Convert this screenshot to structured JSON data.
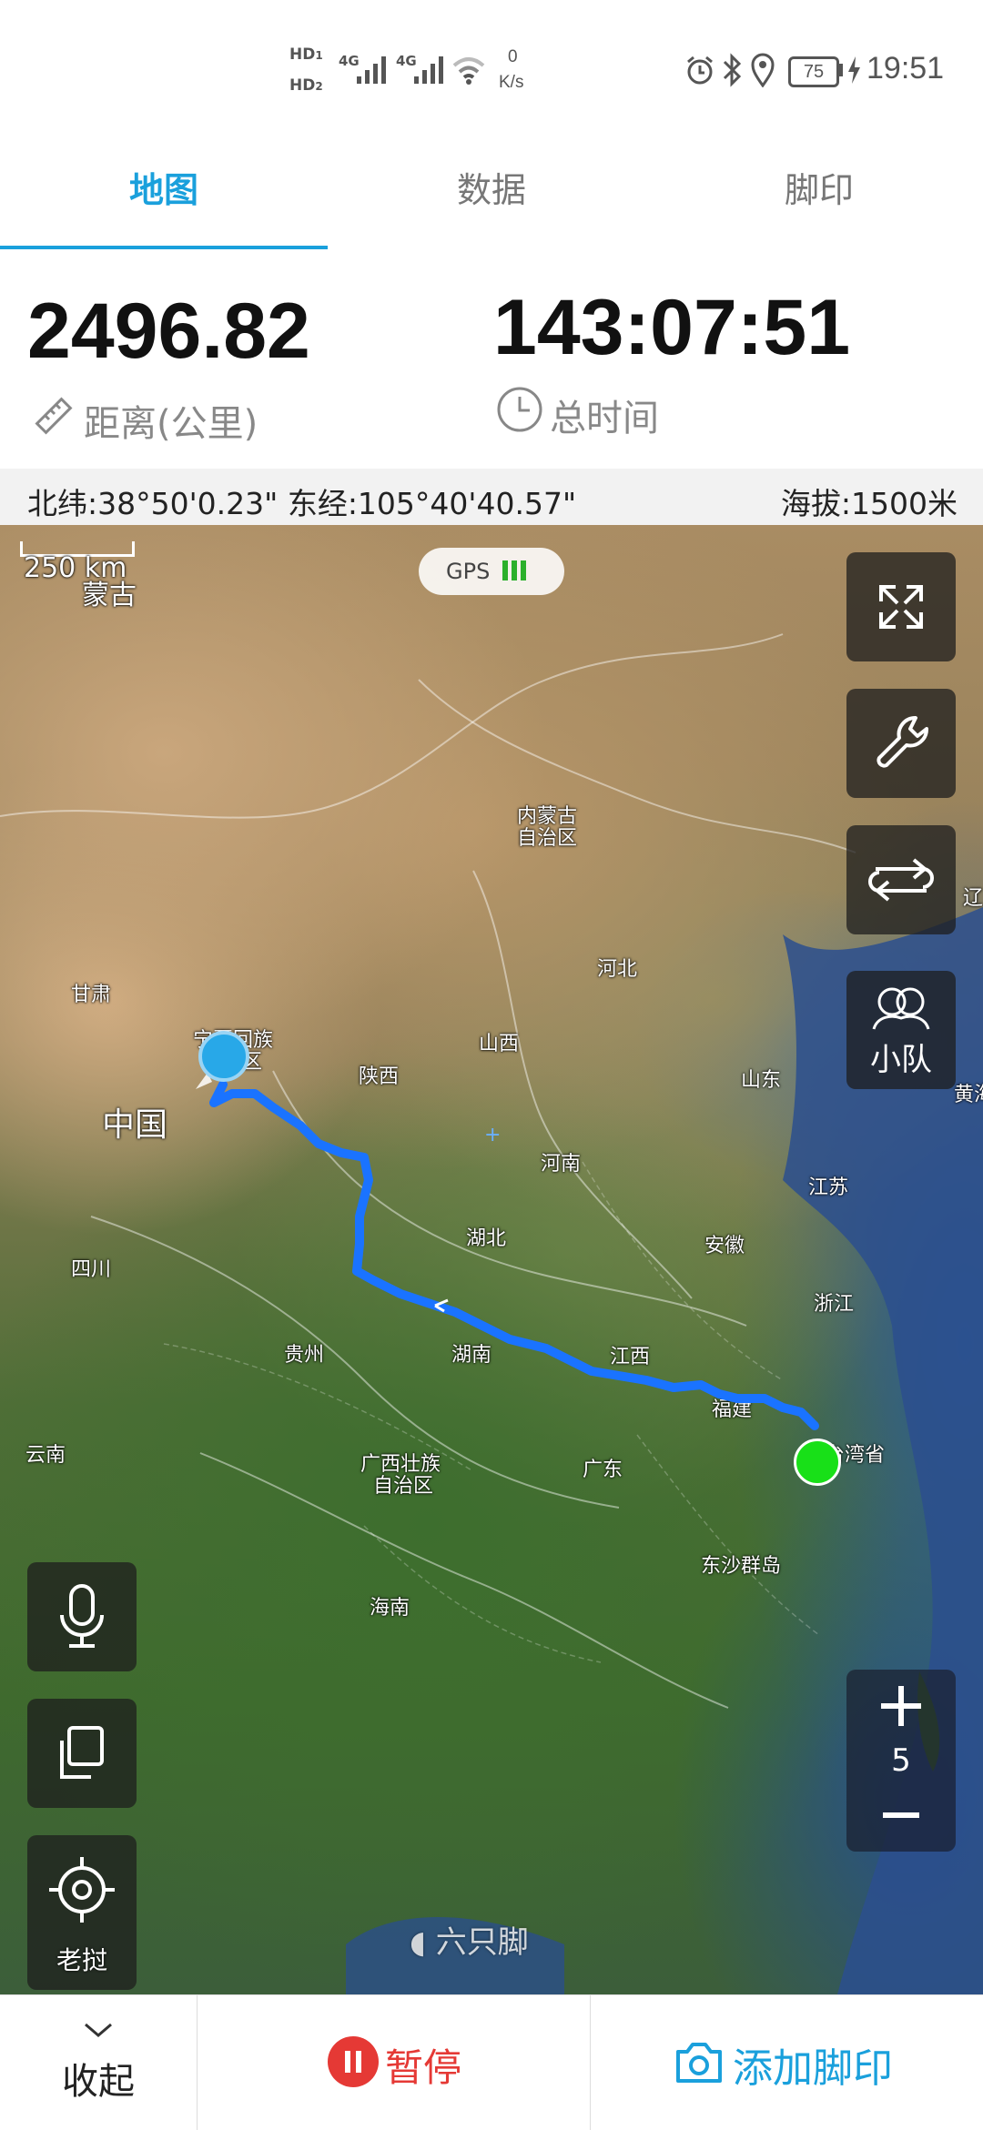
{
  "status_bar": {
    "hd1": "HD",
    "hd1_sub": "1",
    "hd2": "HD",
    "hd2_sub": "2",
    "signal1": "4G",
    "signal2": "4G",
    "net_speed_value": "0",
    "net_speed_unit": "K/s",
    "battery": "75",
    "time": "19:51",
    "icons": [
      "alarm-icon",
      "bluetooth-icon",
      "location-icon",
      "battery-icon",
      "charging-icon"
    ]
  },
  "tabs": [
    {
      "label": "地图",
      "active": true
    },
    {
      "label": "数据",
      "active": false
    },
    {
      "label": "脚印",
      "active": false
    }
  ],
  "stats": {
    "distance_value": "2496.82",
    "distance_label": "距离(公里)",
    "time_value": "143:07:51",
    "time_label": "总时间"
  },
  "coords": {
    "latlng": "北纬:38°50'0.23\" 东经:105°40'40.57\"",
    "altitude": "海拔:1500米"
  },
  "map": {
    "scale": "250 km",
    "gps_label": "GPS",
    "labels": {
      "mongolia": "蒙古",
      "inner_mongolia_1": "内蒙古",
      "inner_mongolia_2": "自治区",
      "gansu": "甘肃",
      "ningxia_1": "宁夏回族",
      "ningxia_2": "自治区",
      "hebei": "河北",
      "shanxi": "山西",
      "shaanxi": "陕西",
      "shandong": "山东",
      "china": "中国",
      "henan": "河南",
      "jiangsu": "江苏",
      "hubei": "湖北",
      "anhui": "安徽",
      "sichuan": "四川",
      "zhejiang": "浙江",
      "guizhou": "贵州",
      "hunan": "湖南",
      "jiangxi": "江西",
      "fujian": "福建",
      "yunnan": "云南",
      "guangxi_1": "广西壮族",
      "guangxi_2": "自治区",
      "guangdong": "广东",
      "taiwan": "台湾省",
      "hainan": "海南",
      "dongsha": "东沙群岛",
      "yellow_sea": "黄海",
      "liaoning": "辽"
    },
    "team_label": "小队",
    "zoom_level": "5",
    "locate_label": "老挝",
    "watermark": "六只脚",
    "accent": "#1a73ff",
    "start_color": "#18e018"
  },
  "bottom": {
    "collapse_label": "收起",
    "pause_label": "暂停",
    "add_footprint_label": "添加脚印",
    "pause_color": "#e53935",
    "accent": "#1aa0dc"
  }
}
